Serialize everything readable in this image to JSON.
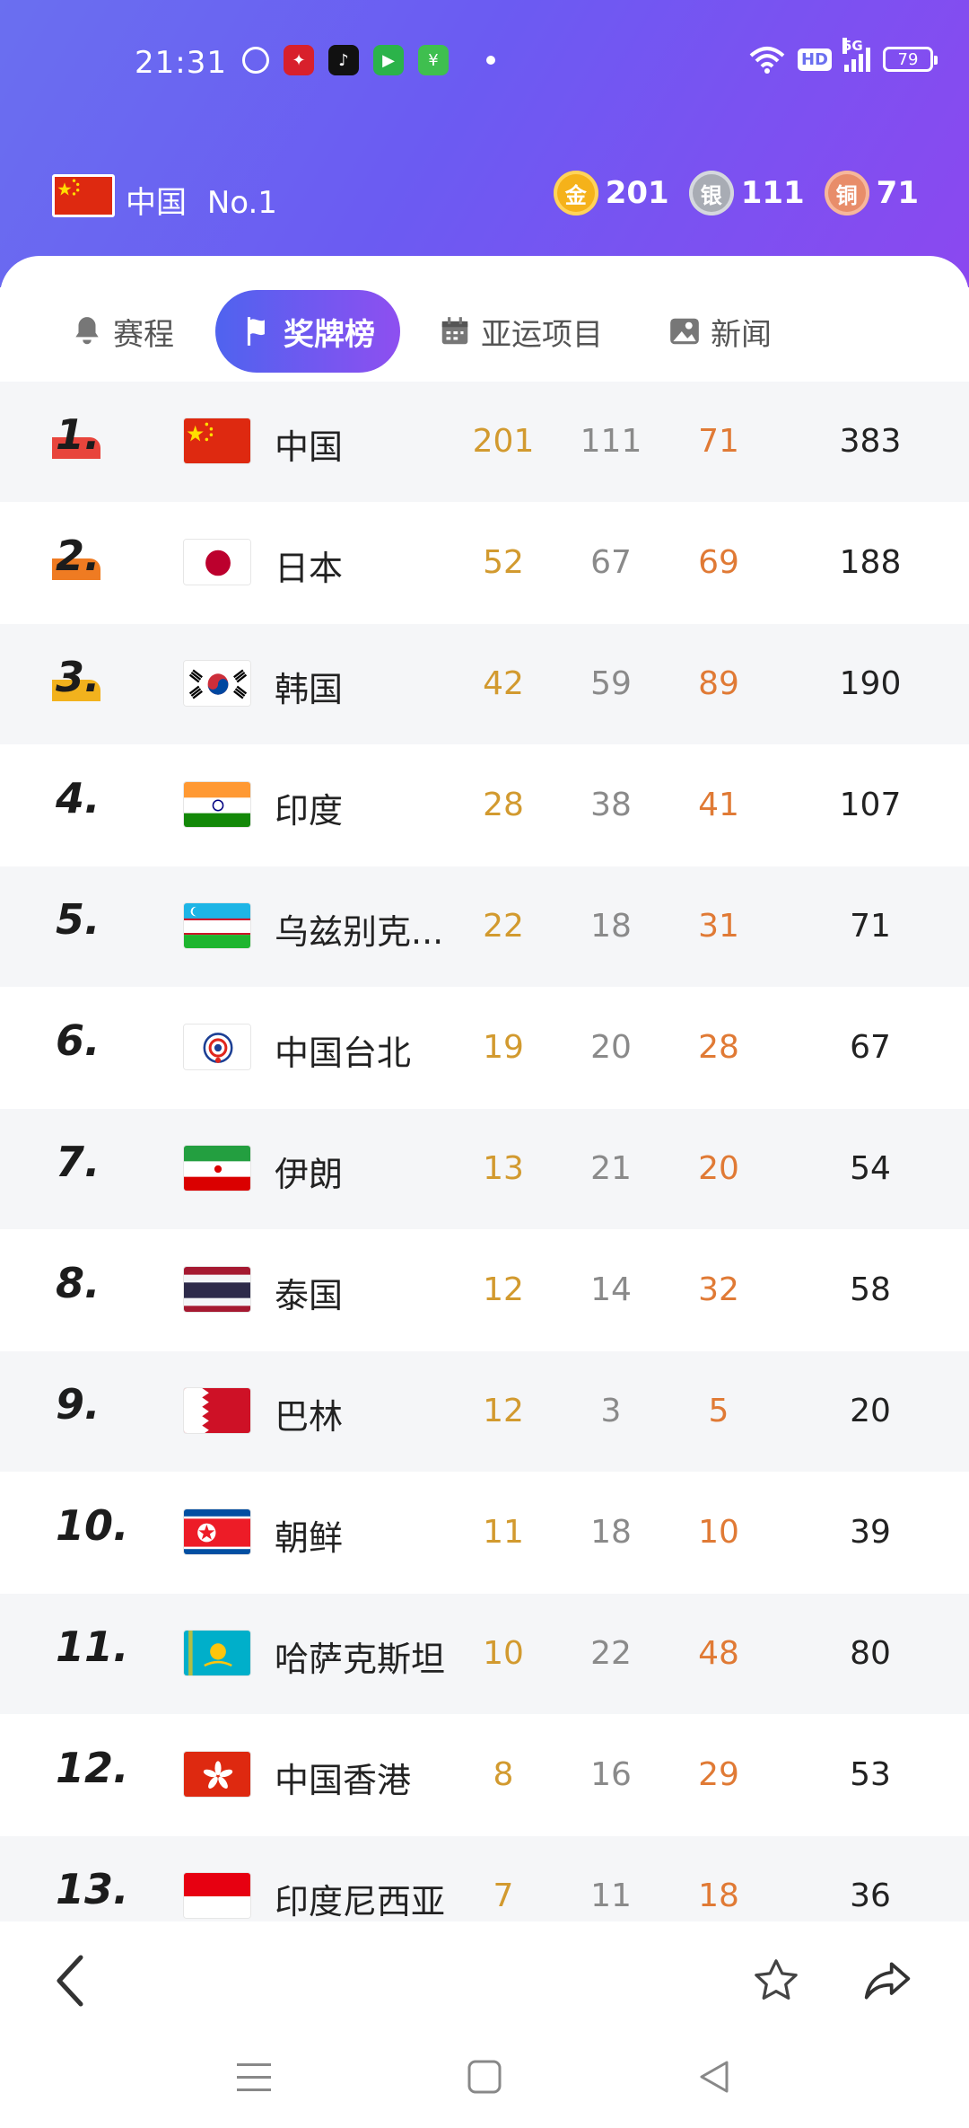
{
  "status_bar": {
    "time": "21:31",
    "battery": "79",
    "network": "5G",
    "hd": "HD"
  },
  "summary": {
    "country": "中国",
    "rank_label": "No.1",
    "gold_label": "金",
    "gold": "201",
    "silver_label": "银",
    "silver": "111",
    "bronze_label": "铜",
    "bronze": "71"
  },
  "tabs": [
    {
      "label": "赛程",
      "icon": "bell-icon"
    },
    {
      "label": "奖牌榜",
      "icon": "flag-icon"
    },
    {
      "label": "亚运项目",
      "icon": "calendar-icon"
    },
    {
      "label": "新闻",
      "icon": "image-icon"
    }
  ],
  "rows": [
    {
      "rank": "1.",
      "name": "中国",
      "gold": "201",
      "silver": "111",
      "bronze": "71",
      "total": "383"
    },
    {
      "rank": "2.",
      "name": "日本",
      "gold": "52",
      "silver": "67",
      "bronze": "69",
      "total": "188"
    },
    {
      "rank": "3.",
      "name": "韩国",
      "gold": "42",
      "silver": "59",
      "bronze": "89",
      "total": "190"
    },
    {
      "rank": "4.",
      "name": "印度",
      "gold": "28",
      "silver": "38",
      "bronze": "41",
      "total": "107"
    },
    {
      "rank": "5.",
      "name": "乌兹别克...",
      "gold": "22",
      "silver": "18",
      "bronze": "31",
      "total": "71"
    },
    {
      "rank": "6.",
      "name": "中国台北",
      "gold": "19",
      "silver": "20",
      "bronze": "28",
      "total": "67"
    },
    {
      "rank": "7.",
      "name": "伊朗",
      "gold": "13",
      "silver": "21",
      "bronze": "20",
      "total": "54"
    },
    {
      "rank": "8.",
      "name": "泰国",
      "gold": "12",
      "silver": "14",
      "bronze": "32",
      "total": "58"
    },
    {
      "rank": "9.",
      "name": "巴林",
      "gold": "12",
      "silver": "3",
      "bronze": "5",
      "total": "20"
    },
    {
      "rank": "10.",
      "name": "朝鲜",
      "gold": "11",
      "silver": "18",
      "bronze": "10",
      "total": "39"
    },
    {
      "rank": "11.",
      "name": "哈萨克斯坦",
      "gold": "10",
      "silver": "22",
      "bronze": "48",
      "total": "80"
    },
    {
      "rank": "12.",
      "name": "中国香港",
      "gold": "8",
      "silver": "16",
      "bronze": "29",
      "total": "53"
    },
    {
      "rank": "13.",
      "name": "印度尼西亚",
      "gold": "7",
      "silver": "11",
      "bronze": "18",
      "total": "36"
    }
  ],
  "colors": {
    "gold_text": "#d29a2f",
    "silver_text": "#8a8a8a",
    "bronze_text": "#e07a35",
    "accent_gradient_start": "#4f63ef",
    "accent_gradient_end": "#8e4ff0"
  }
}
